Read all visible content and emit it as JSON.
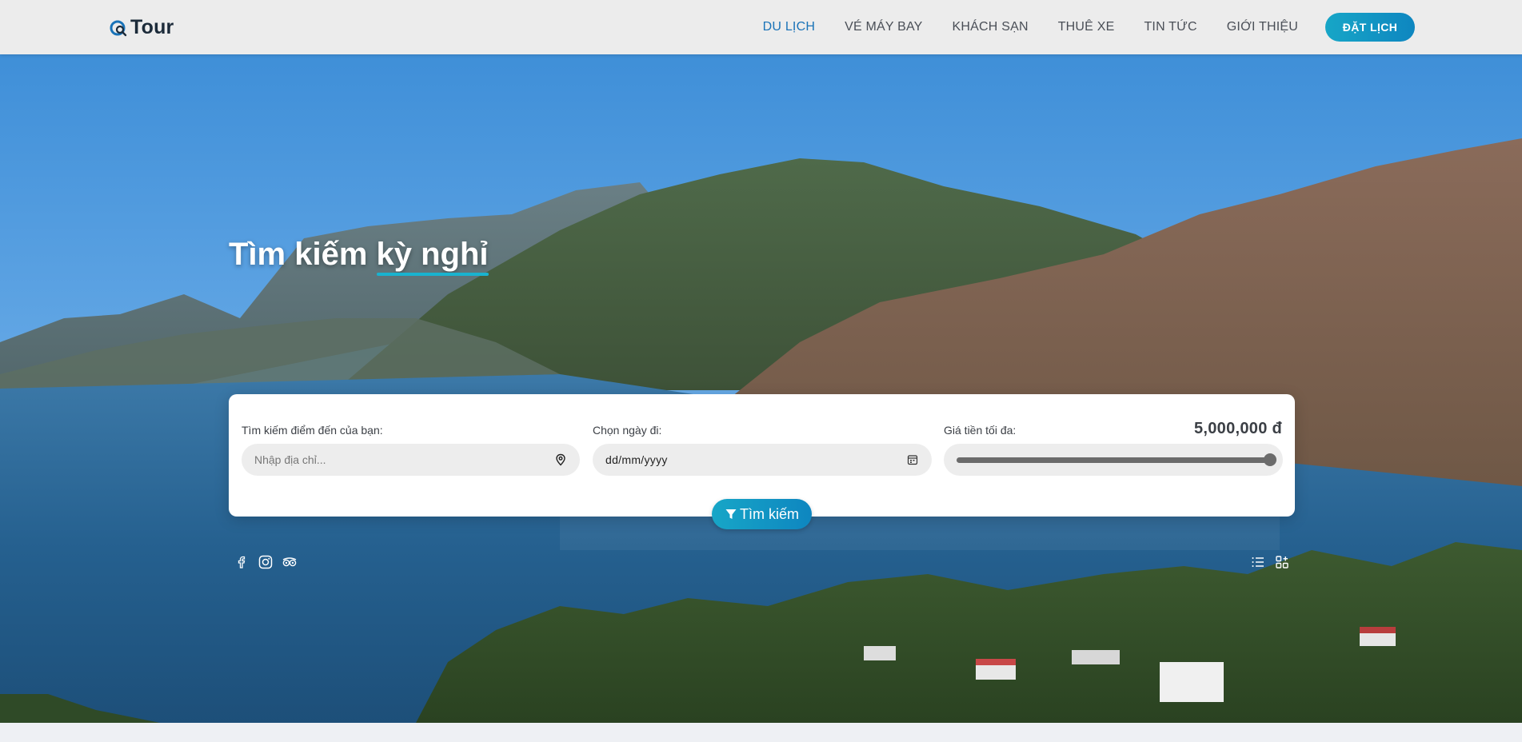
{
  "brand": {
    "logo_text": "Tour",
    "accent": "#1a73b8",
    "button_gradient": [
      "#17a6c7",
      "#0e86c0"
    ]
  },
  "nav": {
    "items": [
      {
        "label": "DU LỊCH",
        "active": true
      },
      {
        "label": "VÉ MÁY BAY"
      },
      {
        "label": "KHÁCH SẠN"
      },
      {
        "label": "THUÊ XE"
      },
      {
        "label": "TIN TỨC"
      },
      {
        "label": "GIỚI THIỆU"
      }
    ],
    "book_button": "ĐẶT LỊCH"
  },
  "hero": {
    "title_plain": "Tìm kiếm ",
    "title_highlight": "kỳ nghỉ"
  },
  "search": {
    "destination_label": "Tìm kiếm điểm đến của bạn:",
    "destination_placeholder": "Nhập địa chỉ...",
    "date_label": "Chọn ngày đi:",
    "date_value": "dd/mm/yyyy",
    "price_label": "Giá tiền tối đa:",
    "price_value": "5,000,000 đ",
    "price_slider_fraction": 1.0,
    "submit_label": "Tìm kiếm"
  },
  "social_icons": [
    "facebook-icon",
    "instagram-icon",
    "tripadvisor-icon"
  ],
  "view_icons": [
    "list-view-icon",
    "grid-view-icon"
  ]
}
